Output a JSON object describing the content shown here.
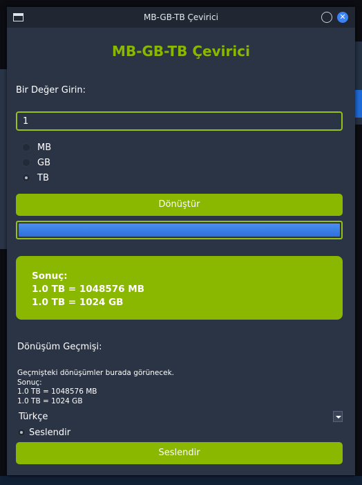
{
  "window": {
    "title": "MB-GB-TB Çevirici"
  },
  "main": {
    "heading": "MB-GB-TB Çevirici",
    "input_label": "Bir Değer Girin:",
    "input_value": "1",
    "units": [
      {
        "label": "MB",
        "checked": false
      },
      {
        "label": "GB",
        "checked": false
      },
      {
        "label": "TB",
        "checked": true
      }
    ],
    "convert_button": "Dönüştür",
    "progress_percent": 100,
    "result": {
      "title": "Sonuç:",
      "line1": "1.0 TB = 1048576 MB",
      "line2": "1.0 TB = 1024 GB"
    }
  },
  "history": {
    "title": "Dönüşüm Geçmişi:",
    "lines": [
      "Geçmişteki dönüşümler burada görünecek.",
      "Sonuç:",
      "1.0 TB = 1048576 MB",
      "1.0 TB = 1024 GB"
    ]
  },
  "footer": {
    "language": "Türkçe",
    "speak_radio_label": "Seslendir",
    "speak_button": "Seslendir"
  },
  "colors": {
    "accent_green": "#8ab800",
    "panel_bg": "#2b3445",
    "progress_blue": "#2e6fdc"
  }
}
